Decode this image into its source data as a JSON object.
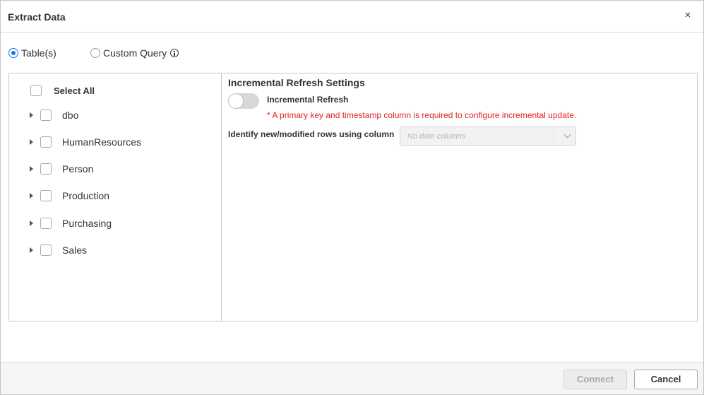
{
  "dialog": {
    "title": "Extract Data",
    "close_symbol": "×"
  },
  "mode": {
    "options": [
      {
        "label": "Table(s)",
        "selected": true
      },
      {
        "label": "Custom Query",
        "selected": false
      }
    ],
    "info_icon": "info-icon"
  },
  "tree": {
    "select_all_label": "Select All",
    "items": [
      {
        "label": "dbo"
      },
      {
        "label": "HumanResources"
      },
      {
        "label": "Person"
      },
      {
        "label": "Production"
      },
      {
        "label": "Purchasing"
      },
      {
        "label": "Sales"
      }
    ]
  },
  "settings": {
    "title": "Incremental Refresh Settings",
    "toggle_label": "Incremental Refresh",
    "toggle_on": false,
    "warning": "* A primary key and timestamp column is required to configure incremental update.",
    "identify_label": "Identify new/modified rows using column",
    "column_placeholder": "No date columns"
  },
  "footer": {
    "connect_label": "Connect",
    "cancel_label": "Cancel"
  },
  "colors": {
    "accent": "#1a73e8",
    "warning": "#e02424"
  }
}
